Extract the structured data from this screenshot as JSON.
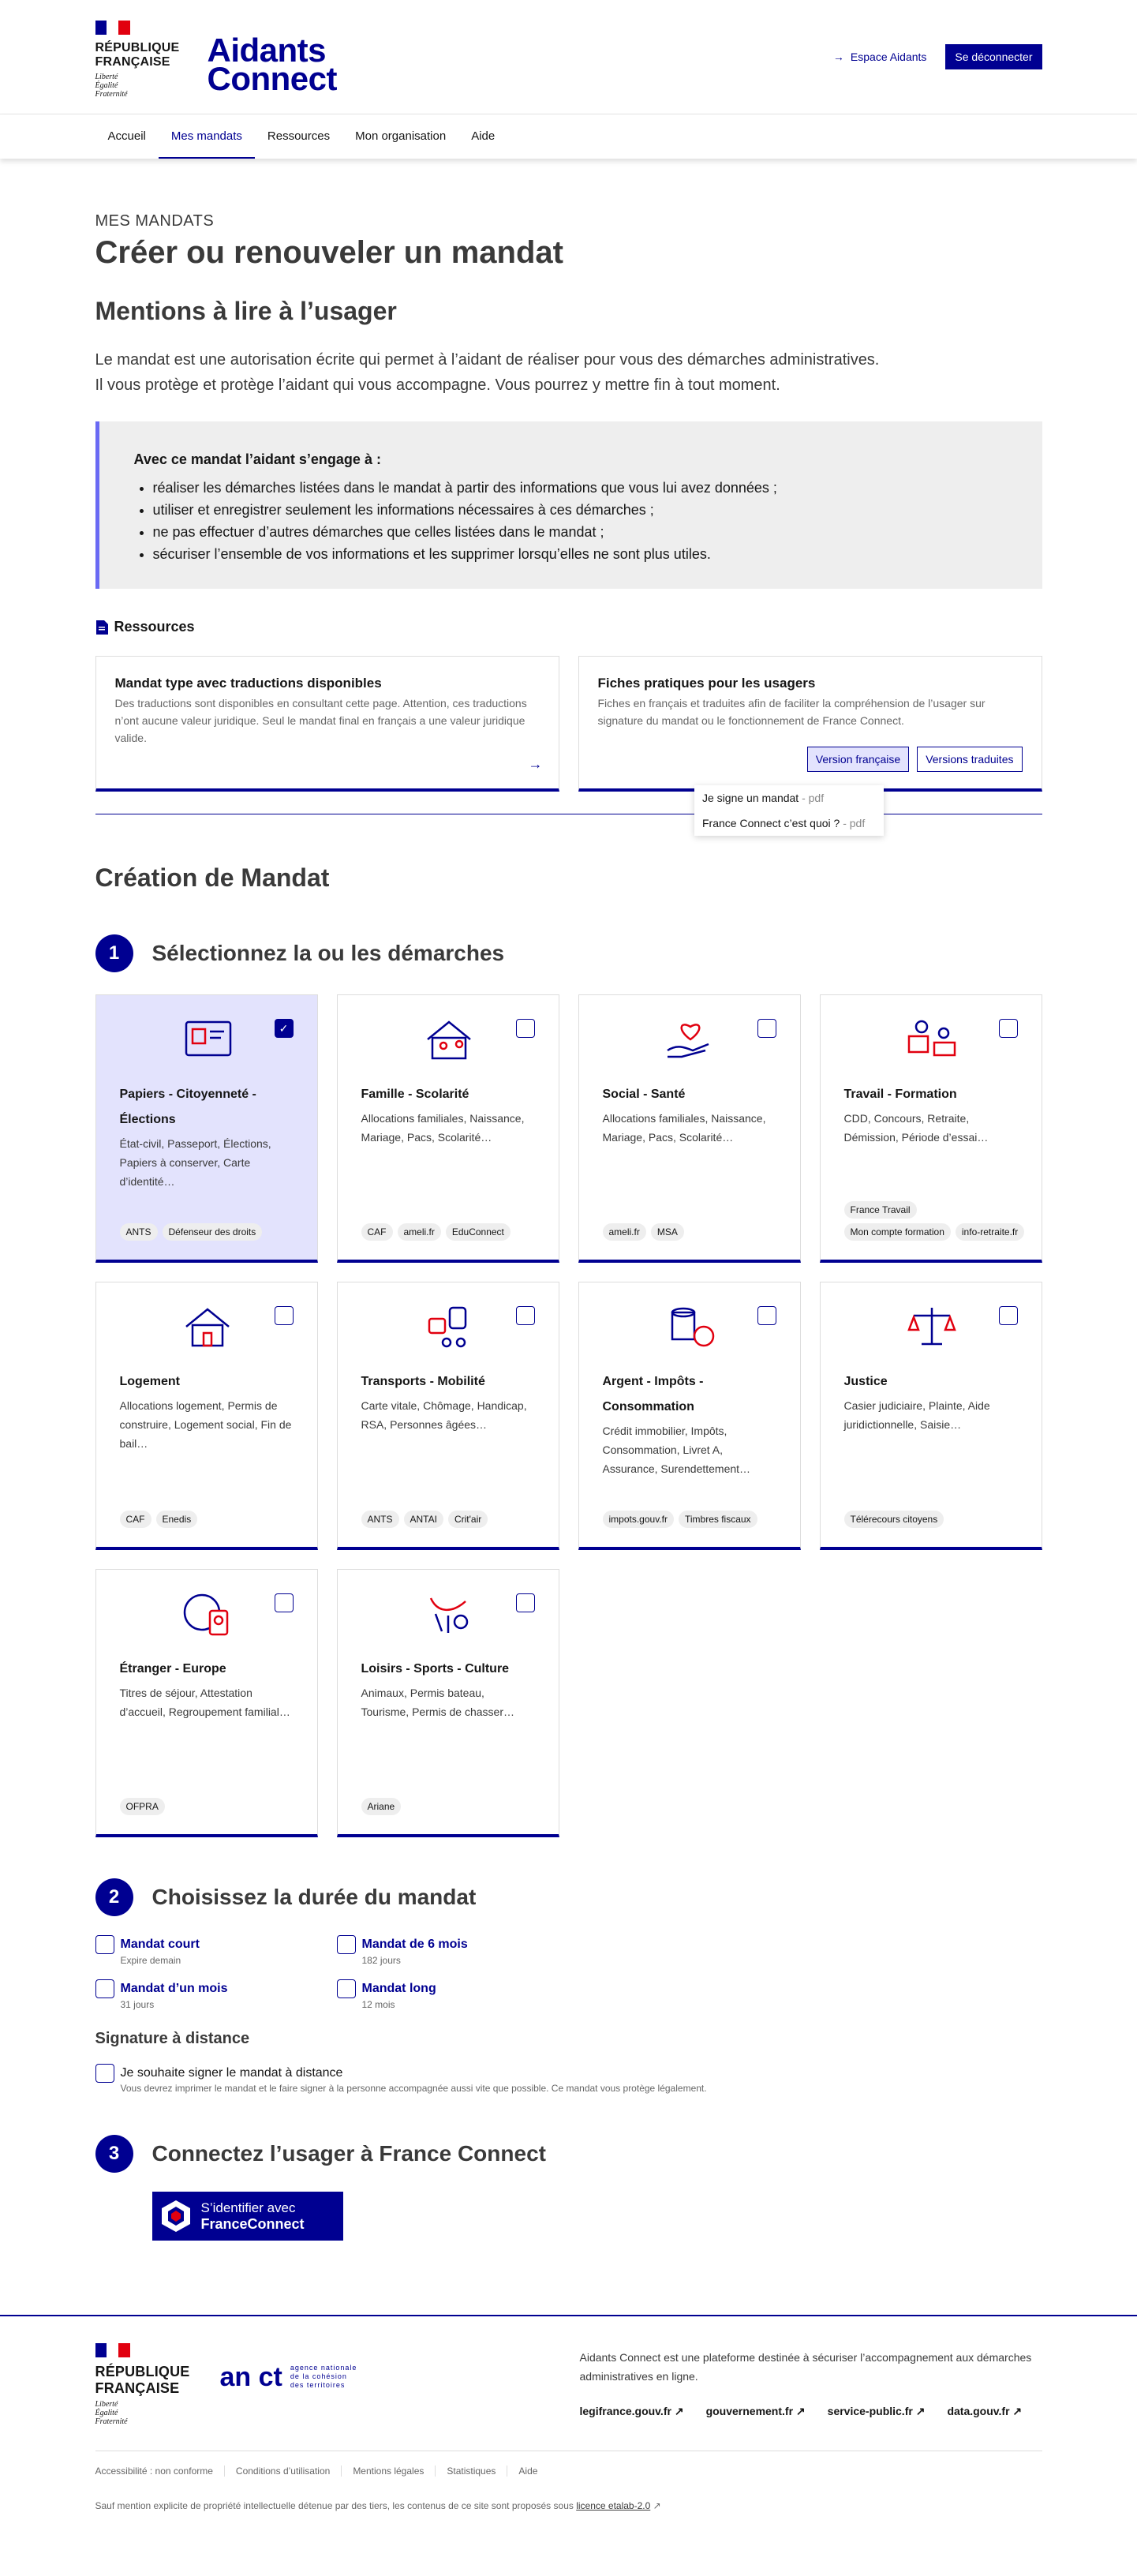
{
  "header": {
    "rf_name_1": "RÉPUBLIQUE",
    "rf_name_2": "FRANÇAISE",
    "rf_motto": [
      "Liberté",
      "Égalité",
      "Fraternité"
    ],
    "brand_1": "Aidants",
    "brand_2": "Connect",
    "espace_link": "Espace Aidants",
    "logout": "Se déconnecter"
  },
  "nav": [
    "Accueil",
    "Mes mandats",
    "Ressources",
    "Mon organisation",
    "Aide"
  ],
  "page": {
    "overline": "MES MANDATS",
    "title": "Créer ou renouveler un mandat",
    "subtitle": "Mentions à lire à l’usager",
    "intro_1": "Le mandat est une autorisation écrite qui permet à l’aidant de réaliser pour vous des démarches administratives.",
    "intro_2": "Il vous protège et protège l’aidant qui vous accompagne. Vous pourrez y mettre fin à tout moment.",
    "callout_title": "Avec ce mandat l’aidant s’engage à :",
    "callout_items": [
      "réaliser les démarches listées dans le mandat à partir des informations que vous lui avez données ;",
      "utiliser et enregistrer seulement les informations nécessaires à ces démarches ;",
      "ne pas effectuer d’autres démarches que celles listées dans le mandat ;",
      "sécuriser l’ensemble de vos informations et les supprimer lorsqu’elles ne sont plus utiles."
    ]
  },
  "resources": {
    "title": "Ressources",
    "card1_title": "Mandat type avec traductions disponibles",
    "card1_desc": "Des traductions sont disponibles en consultant cette page. Attention, ces traductions n’ont aucune valeur juridique. Seul le mandat final en français a une valeur juridique valide.",
    "card2_title": "Fiches pratiques pour les usagers",
    "card2_desc": "Fiches en français et traduites afin de faciliter la compréhension de l’usager sur signature du mandat ou le fonctionnement de France Connect.",
    "btn_fr": "Version française",
    "btn_trad": "Versions traduites",
    "dd_1": "Je signe un mandat",
    "dd_2": "France Connect c’est quoi ?",
    "dd_pdf": "- pdf"
  },
  "creation": {
    "title": "Création de Mandat",
    "step1_num": "1",
    "step1_title": "Sélectionnez la ou les démarches",
    "step2_num": "2",
    "step2_title": "Choisissez la durée du mandat",
    "step3_num": "3",
    "step3_title": "Connectez l’usager à France Connect"
  },
  "demarches": [
    {
      "title": "Papiers - Citoyenneté - Élections",
      "desc": "État-civil, Passeport, Élections, Papiers à conserver, Carte d’identité…",
      "tags": [
        "ANTS",
        "Défenseur des droits"
      ],
      "icon": "id-card-icon",
      "selected": true
    },
    {
      "title": "Famille - Scolarité",
      "desc": "Allocations familiales, Naissance, Mariage, Pacs, Scolarité…",
      "tags": [
        "CAF",
        "ameli.fr",
        "EduConnect"
      ],
      "icon": "family-house-icon",
      "selected": false
    },
    {
      "title": "Social - Santé",
      "desc": "Allocations familiales, Naissance, Mariage, Pacs, Scolarité…",
      "tags": [
        "ameli.fr",
        "MSA"
      ],
      "icon": "heart-hand-icon",
      "selected": false
    },
    {
      "title": "Travail - Formation",
      "desc": "CDD, Concours, Retraite, Démission, Période d’essai…",
      "tags": [
        "France Travail",
        "Mon compte formation",
        "info-retraite.fr"
      ],
      "icon": "work-training-icon",
      "selected": false
    },
    {
      "title": "Logement",
      "desc": "Allocations logement, Permis de construire, Logement social, Fin de bail…",
      "tags": [
        "CAF",
        "Enedis"
      ],
      "icon": "house-icon",
      "selected": false
    },
    {
      "title": "Transports - Mobilité",
      "desc": "Carte vitale, Chômage, Handicap, RSA, Personnes âgées…",
      "tags": [
        "ANTS",
        "ANTAI",
        "Crit'air"
      ],
      "icon": "transport-icon",
      "selected": false
    },
    {
      "title": "Argent - Impôts - Consommation",
      "desc": "Crédit immobilier, Impôts, Consommation, Livret A, Assurance, Surendettement…",
      "tags": [
        "impots.gouv.fr",
        "Timbres fiscaux"
      ],
      "icon": "coins-icon",
      "selected": false
    },
    {
      "title": "Justice",
      "desc": "Casier judiciaire, Plainte, Aide juridictionnelle, Saisie…",
      "tags": [
        "Télérecours citoyens"
      ],
      "icon": "scales-icon",
      "selected": false
    },
    {
      "title": "Étranger - Europe",
      "desc": "Titres de séjour, Attestation d’accueil, Regroupement familial…",
      "tags": [
        "OFPRA"
      ],
      "icon": "globe-passport-icon",
      "selected": false
    },
    {
      "title": "Loisirs - Sports - Culture",
      "desc": "Animaux, Permis bateau, Tourisme, Permis de chasser…",
      "tags": [
        "Ariane"
      ],
      "icon": "leisure-icon",
      "selected": false
    }
  ],
  "duree": {
    "court": "Mandat court",
    "court_hint": "Expire demain",
    "six": "Mandat de 6 mois",
    "six_hint": "182 jours",
    "mois": "Mandat d’un mois",
    "mois_hint": "31 jours",
    "long": "Mandat long",
    "long_hint": "12 mois"
  },
  "signature": {
    "title": "Signature à distance",
    "label": "Je souhaite signer le mandat à distance",
    "hint": "Vous devrez imprimer le mandat et le faire signer à la personne accompagnée aussi vite que possible. Ce mandat vous protège légalement."
  },
  "franceconnect": {
    "line1": "S’identifier avec",
    "line2": "FranceConnect"
  },
  "footer": {
    "anct_logo": "an ct",
    "anct_text": [
      "agence nationale",
      "de la cohésion",
      "des territoires"
    ],
    "desc": "Aidants Connect est une plateforme destinée à sécuriser l’accompagnement aux démarches administratives en ligne.",
    "links": [
      "legifrance.gouv.fr",
      "gouvernement.fr",
      "service-public.fr",
      "data.gouv.fr"
    ],
    "bottom_links": [
      "Accessibilité : non conforme",
      "Conditions d’utilisation",
      "Mentions légales",
      "Statistiques",
      "Aide"
    ],
    "license_text": "Sauf mention explicite de propriété intellectuelle détenue par des tiers, les contenus de ce site sont proposés sous",
    "license_link": "licence etalab-2.0"
  },
  "colors": {
    "primary": "#000091",
    "accent_red": "#e1000f",
    "selected_bg": "#e3e3fd"
  }
}
